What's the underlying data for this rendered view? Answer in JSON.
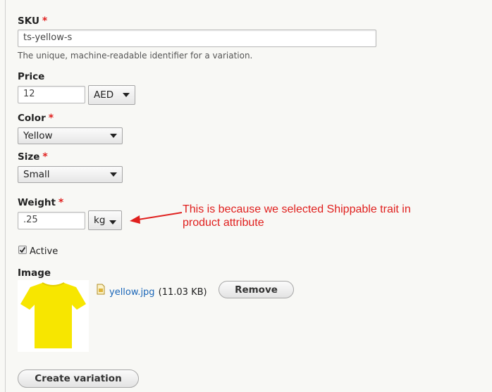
{
  "sku": {
    "label": "SKU",
    "required_mark": "*",
    "value": "ts-yellow-s",
    "description": "The unique, machine-readable identifier for a variation."
  },
  "price": {
    "label": "Price",
    "value": "12",
    "currency": "AED"
  },
  "color": {
    "label": "Color",
    "required_mark": "*",
    "selected": "Yellow"
  },
  "size": {
    "label": "Size",
    "required_mark": "*",
    "selected": "Small"
  },
  "weight": {
    "label": "Weight",
    "required_mark": "*",
    "value": ".25",
    "unit": "kg"
  },
  "annotation": {
    "line1": "This is because we selected Shippable trait in",
    "line2": "product attribute",
    "color": "#e0201e"
  },
  "active": {
    "label": "Active",
    "checked": true
  },
  "image": {
    "label": "Image",
    "file_name": "yellow.jpg",
    "file_size": "(11.03 KB)",
    "remove_label": "Remove",
    "tshirt_color": "#f7e600"
  },
  "actions": {
    "create_label": "Create variation"
  },
  "icons": [
    "file-image-icon",
    "checkmark-icon",
    "chevron-down-icon",
    "arrow-left-icon"
  ]
}
